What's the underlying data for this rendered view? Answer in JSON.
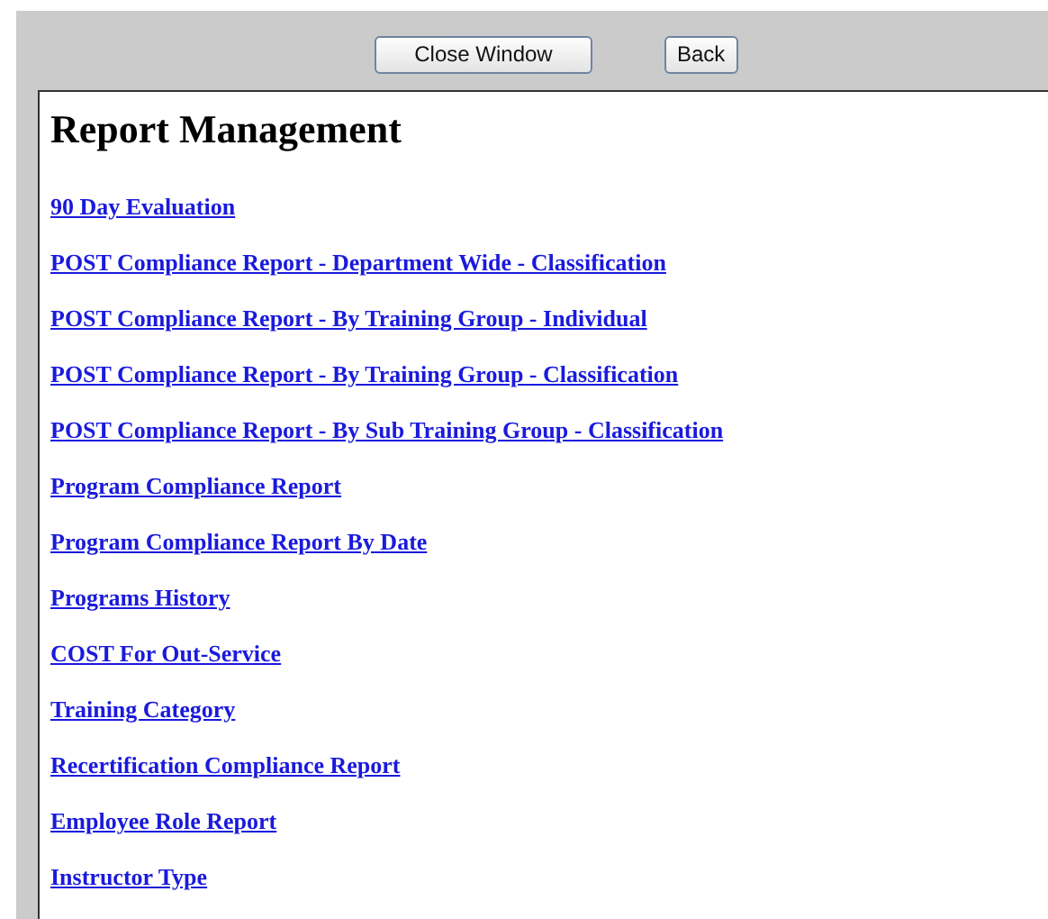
{
  "buttons": [
    "Close Window",
    "Back"
  ],
  "heading": "Report Management",
  "links": [
    "90 Day Evaluation",
    "POST Compliance Report - Department Wide - Classification",
    "POST Compliance Report - By Training Group - Individual",
    "POST Compliance Report - By Training Group - Classification",
    "POST Compliance Report - By Sub Training Group - Classification",
    "Program Compliance Report",
    "Program Compliance Report By Date",
    "Programs History",
    "COST For Out-Service",
    "Training Category",
    "Recertification Compliance Report",
    "Employee Role Report",
    "Instructor Type"
  ]
}
